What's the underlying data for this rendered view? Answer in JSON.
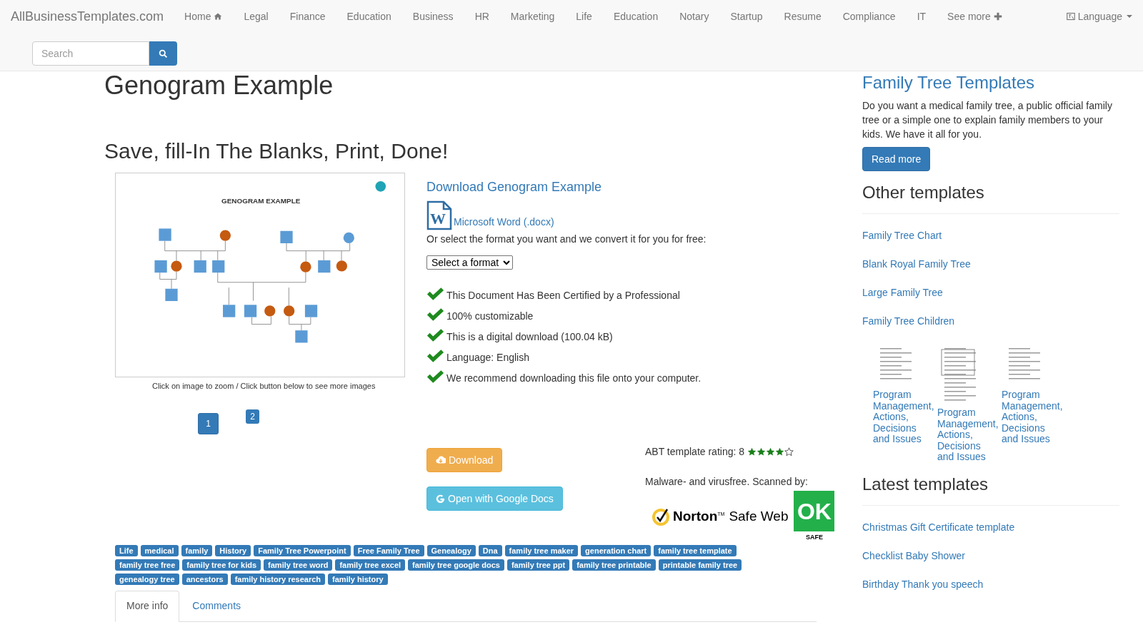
{
  "navbar": {
    "brand": "AllBusinessTemplates.com",
    "items": [
      {
        "label": "Home",
        "kind": "home"
      },
      {
        "label": "Legal",
        "kind": "plain"
      },
      {
        "label": "Finance",
        "kind": "plain"
      },
      {
        "label": "Education",
        "kind": "plain"
      },
      {
        "label": "Business",
        "kind": "plain"
      },
      {
        "label": "HR",
        "kind": "plain"
      },
      {
        "label": "Marketing",
        "kind": "plain"
      },
      {
        "label": "Life",
        "kind": "plain"
      },
      {
        "label": "Education",
        "kind": "plain"
      },
      {
        "label": "Notary",
        "kind": "plain"
      },
      {
        "label": "Startup",
        "kind": "plain"
      },
      {
        "label": "Resume",
        "kind": "plain"
      },
      {
        "label": "Compliance",
        "kind": "plain"
      },
      {
        "label": "IT",
        "kind": "plain"
      },
      {
        "label": "See more",
        "kind": "more"
      }
    ],
    "language": "Language",
    "search": {
      "placeholder": "Search"
    }
  },
  "main": {
    "title": "Genogram Example",
    "subtitle": "Save, fill-In The Blanks, Print, Done!",
    "preview": {
      "document_title": "GENOGRAM EXAMPLE",
      "caption": "Click on image to zoom / Click button below to see more images",
      "pages": [
        {
          "label": "1",
          "selected": true
        },
        {
          "label": "2",
          "selected": false
        }
      ]
    },
    "download": {
      "heading": "Download Genogram Example",
      "format_icon_letter": "W",
      "format_link": "Microsoft Word (.docx)",
      "convert_text": "Or select the format you want and we convert it for you for free:",
      "format_select": "Select a format",
      "features": [
        "This Document Has Been Certified by a Professional",
        "100% customizable",
        "This is a digital download (100.04 kB)",
        "Language: English",
        "We recommend downloading this file onto your computer."
      ],
      "buttons": [
        {
          "label": "Download",
          "kind": "download"
        },
        {
          "label": "Open with Google Docs",
          "kind": "google"
        }
      ],
      "rating": {
        "text": "ABT template rating: 8",
        "stars": 4
      },
      "scan_text": "Malware- and virusfree. Scanned by:",
      "norton": {
        "name": "Norton",
        "tm": "TM",
        "product": "Safe Web",
        "badge": "OK",
        "badge_caption": "SAFE"
      }
    },
    "tags": [
      "Life",
      "medical",
      "family",
      "History",
      "Family Tree Powerpoint",
      "Free Family Tree",
      "Genealogy",
      "Dna",
      "family tree maker",
      "generation chart",
      "family tree template",
      "family tree free",
      "family tree for kids",
      "family tree word",
      "family tree excel",
      "family tree google docs",
      "family tree ppt",
      "family tree printable",
      "printable family tree",
      "genealogy tree",
      "ancestors",
      "family history research",
      "family history"
    ],
    "tabs": [
      {
        "label": "More info",
        "selected": true
      },
      {
        "label": "Comments",
        "selected": false
      }
    ]
  },
  "sidebar": {
    "promo": {
      "title": "Family Tree Templates",
      "text": "Do you want a medical family tree, a public official family tree or a simple one to explain family members to your kids. We have it all for you.",
      "button": "Read more"
    },
    "other": {
      "title": "Other templates",
      "links": [
        "Family Tree Chart",
        "Blank Royal Family Tree",
        "Large Family Tree",
        "Family Tree Children"
      ],
      "thumbnails": [
        {
          "caption": "Program Management, Actions, Decisions and Issues"
        },
        {
          "caption": "Program Management, Actions, Decisions and Issues"
        },
        {
          "caption": "Program Management, Actions, Decisions and Issues"
        }
      ]
    },
    "latest": {
      "title": "Latest templates",
      "links": [
        "Christmas Gift Certificate template",
        "Checklist Baby Shower",
        "Birthday Thank you speech"
      ]
    }
  }
}
